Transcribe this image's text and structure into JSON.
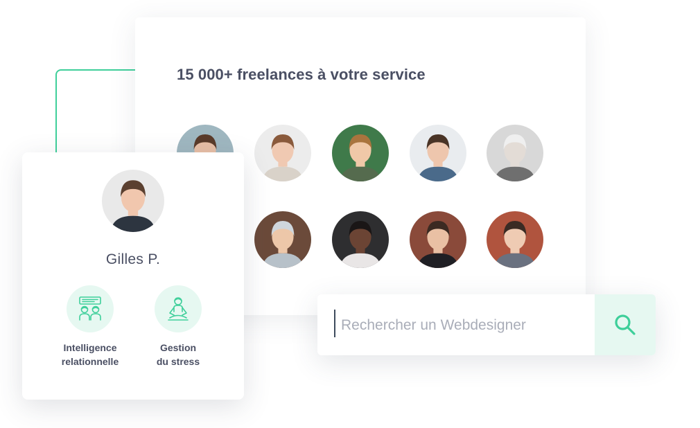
{
  "main_card": {
    "title": "15 000+ freelances à votre service",
    "avatars": [
      {
        "name": "freelancer-1-avatar",
        "bg": "#9fb7c0",
        "skin": "#e8bfa6",
        "hair": "#5a3b2a",
        "shirt": "#3c4f5c"
      },
      {
        "name": "freelancer-2-avatar",
        "bg": "#ececec",
        "skin": "#f0c9b2",
        "hair": "#8a5a3c",
        "shirt": "#d9d2c9"
      },
      {
        "name": "freelancer-3-avatar",
        "bg": "#3f7a4a",
        "skin": "#f0c8a8",
        "hair": "#a9743e",
        "shirt": "#556b4e"
      },
      {
        "name": "freelancer-4-avatar",
        "bg": "#e9ecef",
        "skin": "#eec6ad",
        "hair": "#4a3426",
        "shirt": "#4a6a8a"
      },
      {
        "name": "freelancer-5-avatar",
        "bg": "#d8d8d8",
        "skin": "#e3dcd6",
        "hair": "#efefef",
        "shirt": "#6f6f6f"
      },
      {
        "name": "freelancer-6-avatar",
        "bg": "#6b4a3a",
        "skin": "#edc7a9",
        "hair": "#cfd6dc",
        "shirt": "#b7c1c9"
      },
      {
        "name": "freelancer-7-avatar",
        "bg": "#2e2e30",
        "skin": "#6b4434",
        "hair": "#1a1616",
        "shirt": "#e9e6e6"
      },
      {
        "name": "freelancer-8-avatar",
        "bg": "#8a4a3a",
        "skin": "#e9c0a4",
        "hair": "#3b2a22",
        "shirt": "#1f1f24"
      },
      {
        "name": "freelancer-9-avatar",
        "bg": "#b0543e",
        "skin": "#efcbb3",
        "hair": "#3a2b24",
        "shirt": "#6a7180"
      }
    ]
  },
  "profile": {
    "name": "Gilles P.",
    "avatar": {
      "bg": "#e9e9e9",
      "skin": "#f1c7ae",
      "hair": "#5b4030",
      "shirt": "#2d3540"
    },
    "skills": [
      {
        "label_line1": "Intelligence",
        "label_line2": "relationnelle",
        "icon": "people-chat-icon"
      },
      {
        "label_line1": "Gestion",
        "label_line2": "du stress",
        "icon": "meditation-icon"
      }
    ]
  },
  "search": {
    "placeholder": "Rechercher un Webdesigner",
    "value": "",
    "button_icon": "search-icon"
  },
  "colors": {
    "accent": "#3ecf9a",
    "accent_light": "#e6f8f1",
    "text": "#4a4f63",
    "placeholder": "#a9adb8"
  }
}
